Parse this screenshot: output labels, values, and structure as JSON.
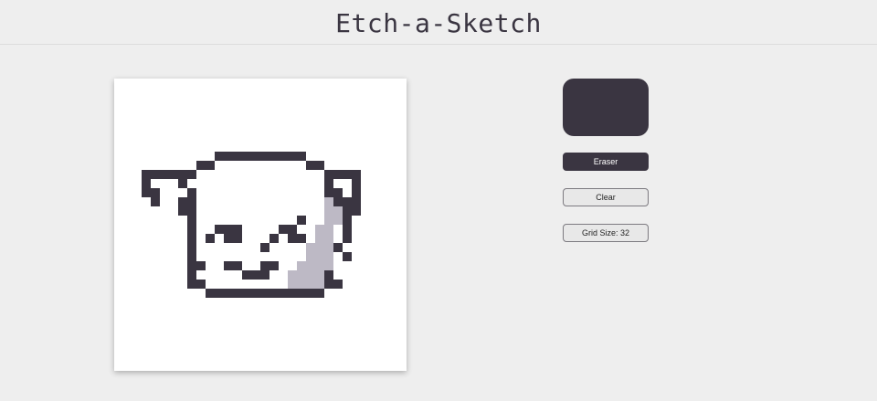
{
  "app": {
    "title": "Etch-a-Sketch"
  },
  "colors": {
    "background": "#eeeeee",
    "canvas": "#ffffff",
    "ink": "#3a3541",
    "shade": "#bdb9c5",
    "selected_color": "#3a3541"
  },
  "controls": {
    "color_swatch_icon": "color-swatch",
    "eraser_label": "Eraser",
    "clear_label": "Clear",
    "grid_size_label": "Grid Size: 32"
  },
  "grid": {
    "size": 32,
    "drawing_rows": [
      "................................",
      "................................",
      "................................",
      "................................",
      "................................",
      "................................",
      "................................",
      "................................",
      "...........DDDDDDDDDD...........",
      ".........DD..........DD.........",
      "...DDDDDD..............DDDD.....",
      "...D...D...............D..D.....",
      "...DD...D..............DD.D.....",
      "....D..DD..............LDDD.....",
      ".......DD..............LLDD.....",
      "........D...........D..LLD......",
      "........D..DDD....DD..LL.D......",
      "........D.D.DD...D.DD.LL.D......",
      "........D.......D....LLLD.......",
      "........D............LLL.D......",
      "........DD..DD..DD..LLLL........",
      "........D.....DDD..LLLLD........",
      "........DD.........LLLLDD.......",
      "..........DDDDDDDDDDDDD.........",
      "................................",
      "................................",
      "................................",
      "................................",
      "................................",
      "................................",
      "................................",
      "................................"
    ]
  }
}
